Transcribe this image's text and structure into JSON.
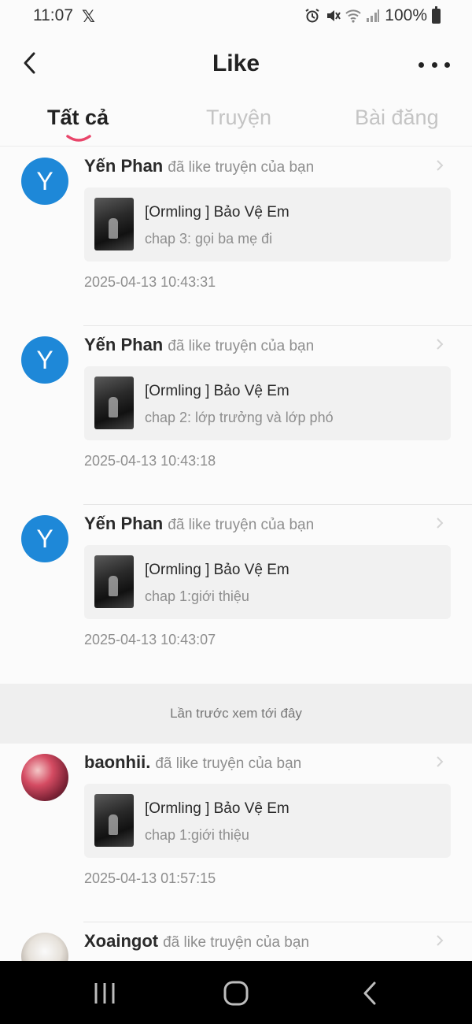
{
  "status": {
    "time": "11:07",
    "battery": "100%"
  },
  "header": {
    "title": "Like"
  },
  "tabs": [
    {
      "label": "Tất cả",
      "active": true
    },
    {
      "label": "Truyện",
      "active": false
    },
    {
      "label": "Bài đăng",
      "active": false
    }
  ],
  "colors": {
    "accent": "#e9456a",
    "avatar_blue": "#1e88d8"
  },
  "notifications": [
    {
      "avatar_letter": "Y",
      "user": "Yến Phan",
      "action": "đã like truyện của bạn",
      "story_title": "[Ormling ] Bảo Vệ Em",
      "chapter": "chap 3: gọi ba mẹ đi",
      "time": "2025-04-13 10:43:31"
    },
    {
      "avatar_letter": "Y",
      "user": "Yến Phan",
      "action": "đã like truyện của bạn",
      "story_title": "[Ormling ] Bảo Vệ Em",
      "chapter": "chap 2: lớp trưởng và lớp phó",
      "time": "2025-04-13 10:43:18"
    },
    {
      "avatar_letter": "Y",
      "user": "Yến Phan",
      "action": "đã like truyện của bạn",
      "story_title": "[Ormling ] Bảo Vệ Em",
      "chapter": "chap 1:giới thiệu",
      "time": "2025-04-13 10:43:07"
    }
  ],
  "seen_divider": "Lần trước xem tới đây",
  "older_notifications": [
    {
      "user": "baonhii.",
      "action": "đã like truyện của bạn",
      "story_title": "[Ormling ] Bảo Vệ Em",
      "chapter": "chap 1:giới thiệu",
      "time": "2025-04-13 01:57:15"
    },
    {
      "user": "Xoaingot",
      "action": "đã like truyện của bạn"
    }
  ]
}
